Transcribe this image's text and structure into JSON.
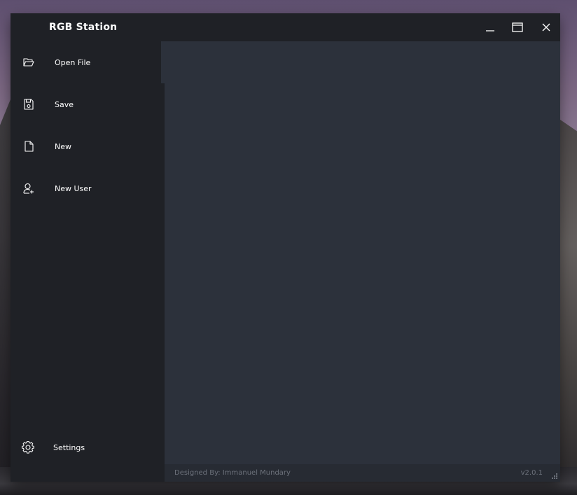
{
  "window": {
    "title": "RGB Station"
  },
  "window_controls": {
    "minimize_icon": "minimize-icon",
    "maximize_icon": "maximize-icon",
    "close_icon": "close-icon"
  },
  "sidebar": {
    "items": [
      {
        "label": "Open File",
        "icon": "folder-open-icon"
      },
      {
        "label": "Save",
        "icon": "floppy-disk-icon"
      },
      {
        "label": "New",
        "icon": "new-file-icon"
      },
      {
        "label": "New User",
        "icon": "add-user-icon"
      }
    ],
    "settings": {
      "label": "Settings",
      "icon": "gear-icon"
    }
  },
  "footer": {
    "credit": "Designed By: Immanuel Mundary",
    "version": "v2.0.1"
  },
  "colors": {
    "sidebar_bg": "#1f2126",
    "content_bg": "#2c313b",
    "footer_bg": "#272b33",
    "footer_text": "#6c717b",
    "text": "#ffffff"
  }
}
